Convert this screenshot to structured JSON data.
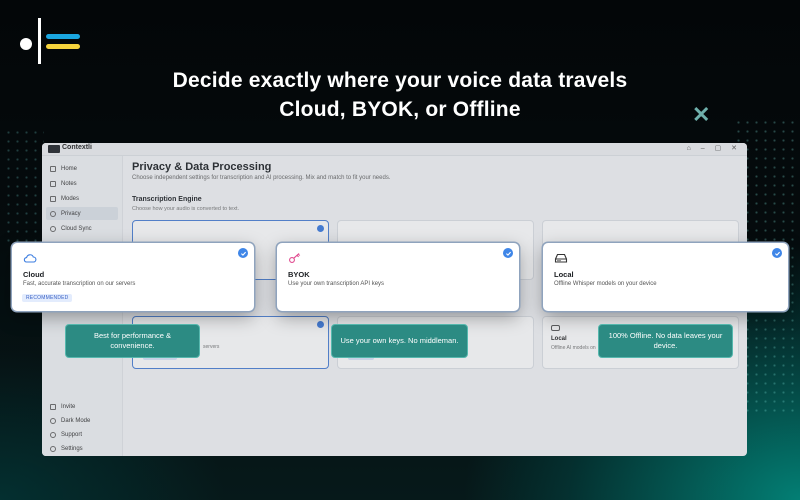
{
  "headline": {
    "line1": "Decide exactly where your voice data travels",
    "line2": "Cloud, BYOK, or Offline"
  },
  "decor": {
    "close_symbol": "✕"
  },
  "app": {
    "name": "Contextli",
    "window_controls": "⌂ – ▢ ✕",
    "sidebar": {
      "items": [
        {
          "label": "Home",
          "icon": "home-icon"
        },
        {
          "label": "Notes",
          "icon": "notes-icon"
        },
        {
          "label": "Modes",
          "icon": "modes-icon"
        },
        {
          "label": "Privacy",
          "icon": "privacy-icon",
          "active": true
        },
        {
          "label": "Cloud Sync",
          "icon": "cloud-icon"
        }
      ],
      "bottom_items": [
        {
          "label": "Invite",
          "icon": "invite-icon"
        },
        {
          "label": "Dark Mode",
          "icon": "moon-icon"
        },
        {
          "label": "Support",
          "icon": "support-icon"
        },
        {
          "label": "Settings",
          "icon": "gear-icon"
        }
      ]
    },
    "page": {
      "title": "Privacy & Data Processing",
      "subtitle": "Choose independent settings for transcription and AI processing. Mix and match to fit your needs.",
      "section_title": "Transcription Engine",
      "section_subtitle": "Choose how your audio is converted to text."
    },
    "background_cards": {
      "second_row_desc": "servers",
      "local_title": "Local",
      "local_desc": "Offline AI models on"
    }
  },
  "options": [
    {
      "title": "Cloud",
      "description": "Fast, accurate transcription on our servers",
      "badge": "RECOMMENDED",
      "icon": "cloud-icon",
      "icon_color": "#3b7de0"
    },
    {
      "title": "BYOK",
      "description": "Use your own transcription API keys",
      "icon": "key-icon",
      "icon_color": "#e04a8f"
    },
    {
      "title": "Local",
      "description": "Offline Whisper models on your device",
      "icon": "hard-drive-icon",
      "icon_color": "#333333"
    }
  ],
  "tooltips": {
    "cloud": "Best for performance & convenience.",
    "byok": "Use your own keys. No middleman.",
    "local": "100% Offline. No data leaves your device."
  },
  "colors": {
    "accent": "#3f86e8",
    "tooltip_bg": "#2c8b83",
    "logo_blue": "#1aa6e0",
    "logo_yellow": "#f6d43c"
  }
}
